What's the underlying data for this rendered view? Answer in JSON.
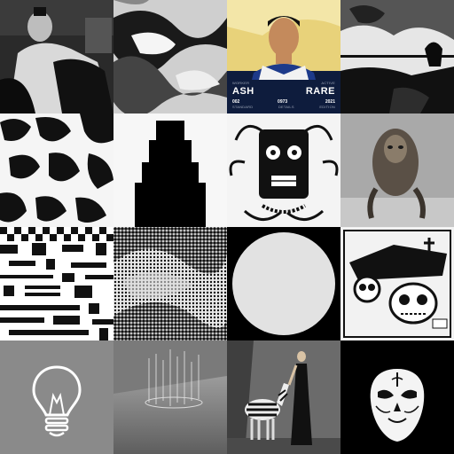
{
  "card": {
    "top_left": "WORKER",
    "top_right": "ACTIVE",
    "name": "ASH",
    "rarity": "RARE",
    "field_1": "002",
    "field_2": "0973",
    "field_3": "2021",
    "sub_1": "STANDARD",
    "sub_2": "DETAILS",
    "sub_3": "EDITION"
  },
  "colors": {
    "background": "#000000",
    "card_bg": "#0e1c3d",
    "card_sky": "#e8d27a",
    "grey_tile": "#8a8a8a"
  }
}
